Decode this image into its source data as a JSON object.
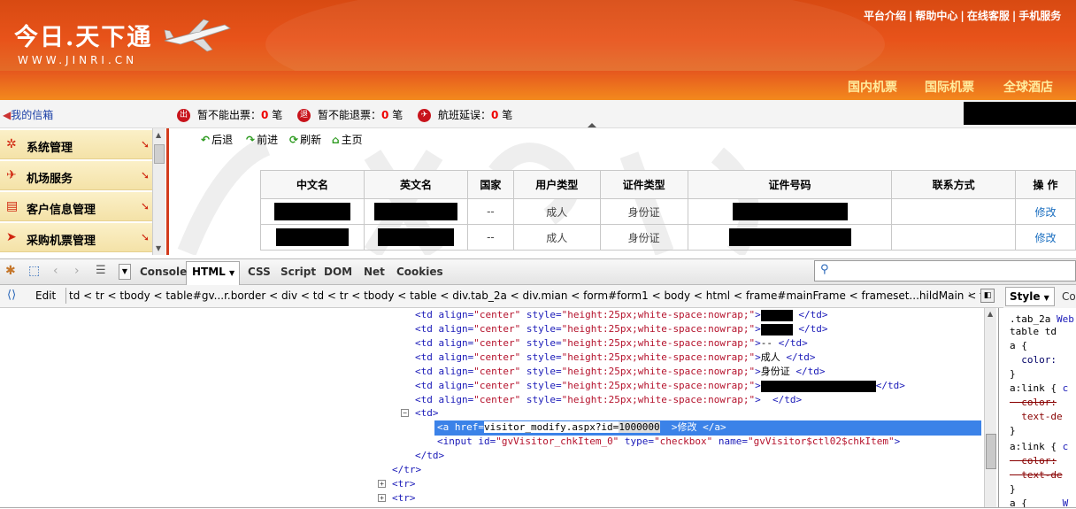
{
  "header": {
    "logo_text": "今日.天下通",
    "logo_url": "WWW.JINRI.CN",
    "top_links": [
      "平台介绍",
      "帮助中心",
      "在线客服",
      "手机服务"
    ],
    "nav_items": [
      "国内机票",
      "国际机票",
      "全球酒店"
    ]
  },
  "statusbar": {
    "mailbox": "我的信箱",
    "stats": [
      {
        "icon": "出",
        "label": "暂不能出票：",
        "count": "0",
        "unit": "笔"
      },
      {
        "icon": "退",
        "label": "暂不能退票：",
        "count": "0",
        "unit": "笔"
      },
      {
        "icon": "✈",
        "label": "航班延误：",
        "count": "0",
        "unit": "笔"
      }
    ]
  },
  "sidebar": {
    "items": [
      {
        "label": "系统管理",
        "icon": "gear-icon"
      },
      {
        "label": "机场服务",
        "icon": "plane-icon"
      },
      {
        "label": "客户信息管理",
        "icon": "card-icon"
      },
      {
        "label": "采购机票管理",
        "icon": "cursor-icon"
      }
    ]
  },
  "toolbar": {
    "back": "后退",
    "forward": "前进",
    "refresh": "刷新",
    "home": "主页"
  },
  "grid": {
    "headers": [
      "中文名",
      "英文名",
      "国家",
      "用户类型",
      "证件类型",
      "证件号码",
      "联系方式",
      "操 作"
    ],
    "rows": [
      {
        "country": "--",
        "user_type": "成人",
        "id_type": "身份证",
        "action": "修改"
      },
      {
        "country": "--",
        "user_type": "成人",
        "id_type": "身份证",
        "action": "修改"
      }
    ]
  },
  "firebug": {
    "tabs": [
      "Console",
      "HTML",
      "CSS",
      "Script",
      "DOM",
      "Net",
      "Cookies"
    ],
    "active_tab": "HTML",
    "edit_label": "Edit",
    "breadcrumb": "td < tr < tbody < table#gv...r.border < div < td < tr < tbody < table < div.tab_2a < div.mian < form#form1 < body < html < frame#mainFrame < frameset...hildMain < fra",
    "side_tabs": [
      "Style",
      "Con"
    ],
    "code": {
      "td_open": "<td",
      "attr_align": "align=",
      "val_center": "\"center\"",
      "attr_style": "style=",
      "val_style": "\"height:25px;white-space:nowrap;\"",
      "close_td": "</td>",
      "gt": ">",
      "dashes": "--",
      "adult": "成人",
      "idcard": "身份证",
      "space": " ",
      "td_plain": "<td>",
      "a_open": "<a href=",
      "href_val": "visitor_modify.aspx?id=",
      "id_val": "1000000",
      "a_text": "修改",
      "a_close": "</a>",
      "input_line_1": "<input id=",
      "input_id": "\"gvVisitor_chkItem_0\"",
      "input_type": " type=",
      "input_type_val": "\"checkbox\"",
      "input_name": " name=",
      "input_name_val": "\"gvVisitor$ctl02$chkItem\"",
      "tr_close": "</tr>",
      "tr_open": "<tr>"
    },
    "style_pane": {
      "l1": ".tab_2a",
      "l1b": "Web",
      "l2": "table td",
      "l3": "a {",
      "l4": "  color:",
      "l5": "}",
      "l6": "a:link {",
      "l6b": "c",
      "l7": "  color:",
      "l8": "  text-de",
      "l9": "}",
      "l10": "a:link {",
      "l10b": "c",
      "l11": "  color:",
      "l12": "  text-de",
      "l13": "}",
      "l14": "a {",
      "l14b": "W"
    }
  },
  "colors": {
    "brand": "#e8531a",
    "nav_text": "#ffec9e",
    "highlight": "#3b82e8"
  }
}
